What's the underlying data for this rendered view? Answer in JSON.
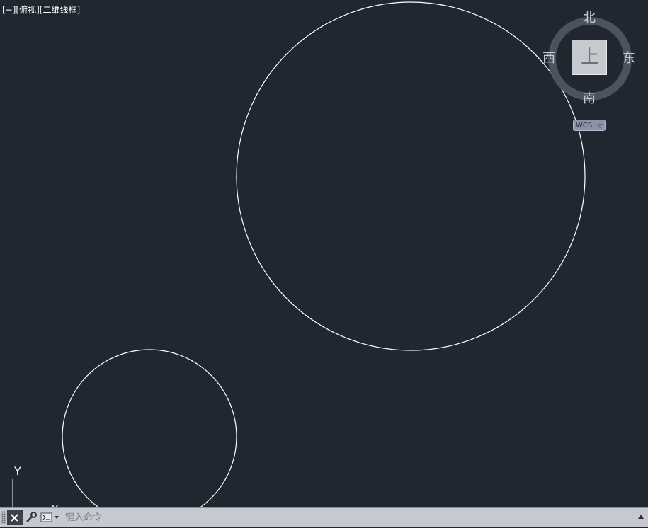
{
  "viewport": {
    "label": "[−][俯视][二维线框]",
    "background": "#212731",
    "entity_color": "#ffffff"
  },
  "viewcube": {
    "north": "北",
    "south": "南",
    "east": "东",
    "west": "西",
    "face": "上",
    "coordinate_system": "WCS"
  },
  "ucs_icon": {
    "x_label": "X",
    "y_label": "Y"
  },
  "command_line": {
    "placeholder": "键入命令",
    "value": "",
    "close_icon": "close-icon",
    "customize_icon": "wrench-icon",
    "recent_icon": "command-prompt-icon",
    "scroll_icon": "triangle-up-icon"
  }
}
